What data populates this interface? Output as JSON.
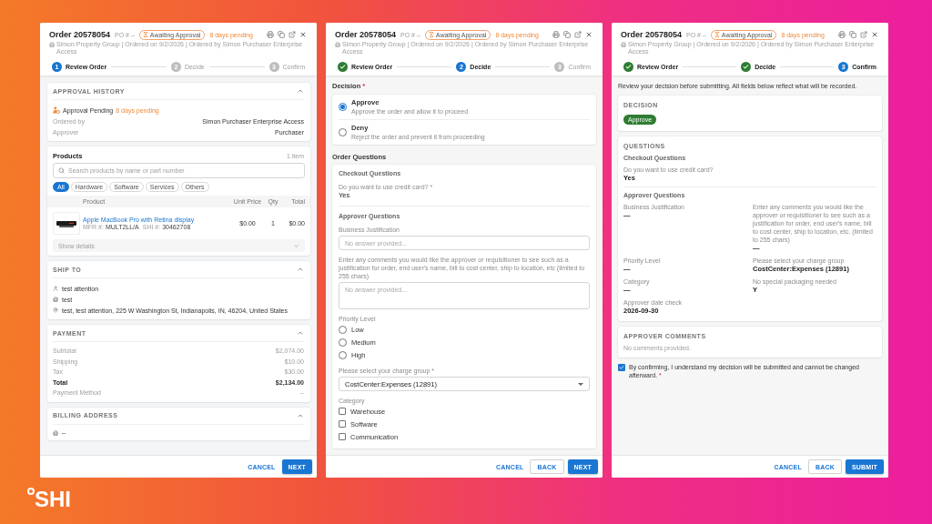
{
  "panels": [
    {
      "kind": "review",
      "header": {
        "title": "Order 20578054",
        "po": "PO # –",
        "badge": "Awaiting Approval",
        "pending": "8 days pending",
        "meta": "Simon Property Group | Ordered on 9/2/2026 | Ordered by Simon Purchaser Enterprise Access"
      },
      "steps": [
        {
          "kind": "current",
          "number": "1",
          "label": "Review Order"
        },
        {
          "kind": "upcoming",
          "number": "2",
          "label": "Decide"
        },
        {
          "kind": "upcoming",
          "number": "3",
          "label": "Confirm"
        }
      ],
      "sections": [
        {
          "kind": "history",
          "title": "APPROVAL HISTORY",
          "expanded": true,
          "status": "Approval Pending",
          "status_note": "8 days pending",
          "rows": [
            {
              "label": "Ordered by",
              "value": "Simon Purchaser Enterprise Access"
            },
            {
              "label": "Approver",
              "value": "Purchaser"
            }
          ]
        },
        {
          "kind": "products",
          "title": "Products",
          "count": "1 item",
          "search": {
            "placeholder": "Search products by name or part number"
          },
          "filters": [
            {
              "label": "All",
              "selected": true
            },
            {
              "label": "Hardware",
              "selected": false
            },
            {
              "label": "Software",
              "selected": false
            },
            {
              "label": "Services",
              "selected": false
            },
            {
              "label": "Others",
              "selected": false
            }
          ],
          "columns": [
            "Product",
            "Unit Price",
            "Qty",
            "Total"
          ],
          "rows": [
            {
              "name": "Apple MacBook Pro with Retina display",
              "mfr_label": "MFR #:",
              "mfr": "MULT2LL/A",
              "shi_label": "SHI #:",
              "shi": "30462708",
              "unit_price": "$0.00",
              "qty": "1",
              "total": "$0.00",
              "details": "Show details"
            }
          ]
        },
        {
          "kind": "address",
          "title": "SHIP TO",
          "expanded": true,
          "lines": [
            {
              "kind": "attention",
              "text": "test attention"
            },
            {
              "kind": "company",
              "text": "test"
            },
            {
              "kind": "location",
              "text": "test, test attention, 225 W Washington St, Indianapolis, IN, 46204, United States"
            }
          ]
        },
        {
          "kind": "payment",
          "title": "PAYMENT",
          "expanded": true,
          "rows": [
            {
              "kind": "line",
              "label": "Subtotal",
              "value": "$2,074.00"
            },
            {
              "kind": "line",
              "label": "Shipping",
              "value": "$10.00"
            },
            {
              "kind": "line",
              "label": "Tax",
              "value": "$30.00"
            },
            {
              "kind": "total",
              "label": "Total",
              "value": "$2,134.00"
            },
            {
              "kind": "line",
              "label": "Payment Method",
              "value": "–"
            }
          ]
        },
        {
          "kind": "address",
          "title": "BILLING ADDRESS",
          "expanded": true,
          "lines": [
            {
              "kind": "company",
              "text": "–"
            }
          ]
        }
      ],
      "buttons": [
        {
          "kind": "text",
          "label": "CANCEL"
        },
        {
          "kind": "primary",
          "label": "NEXT"
        }
      ]
    },
    {
      "kind": "decide",
      "header": {
        "title": "Order 20578054",
        "po": "PO # –",
        "badge": "Awaiting Approval",
        "pending": "8 days pending",
        "meta": "Simon Property Group | Ordered on 9/2/2026 | Ordered by Simon Purchaser Enterprise Access"
      },
      "steps": [
        {
          "kind": "done",
          "label": "Review Order"
        },
        {
          "kind": "current",
          "number": "2",
          "label": "Decide"
        },
        {
          "kind": "upcoming",
          "number": "3",
          "label": "Confirm"
        }
      ],
      "decision": {
        "label": "Decision",
        "required_mark": "*",
        "options": [
          {
            "label": "Approve",
            "description": "Approve the order and allow it to proceed",
            "selected": true
          },
          {
            "label": "Deny",
            "description": "Reject the order and prevent it from proceeding",
            "selected": false
          }
        ]
      },
      "questions": {
        "title": "Order Questions",
        "groups": [
          {
            "title": "Checkout Questions",
            "fields": [
              {
                "kind": "answer",
                "label": "Do you want to use credit card? *",
                "value": "Yes"
              }
            ]
          },
          {
            "title": "Approver Questions",
            "fields": [
              {
                "kind": "input",
                "label": "Business Justification",
                "placeholder": "No answer provided..."
              },
              {
                "kind": "textarea",
                "label": "Enter any comments you would like the approver or requisitioner to see such as a justification for order, end user's name, bill to cost center, ship to location, etc (limited to 255 chars)",
                "placeholder": "No answer provided..."
              },
              {
                "kind": "radio",
                "label": "Priority Level",
                "options": [
                  {
                    "label": "Low",
                    "selected": false
                  },
                  {
                    "label": "Medium",
                    "selected": false
                  },
                  {
                    "label": "High",
                    "selected": false
                  }
                ]
              },
              {
                "kind": "select",
                "label": "Please select your charge group *",
                "value": "CostCenter:Expenses (12891)"
              },
              {
                "kind": "checkbox",
                "label": "Category",
                "options": [
                  {
                    "label": "Warehouse",
                    "checked": false
                  },
                  {
                    "label": "Software",
                    "checked": false
                  },
                  {
                    "label": "Communication",
                    "checked": false
                  }
                ]
              }
            ]
          }
        ]
      },
      "buttons": [
        {
          "kind": "text",
          "label": "CANCEL"
        },
        {
          "kind": "outlined",
          "label": "BACK"
        },
        {
          "kind": "primary",
          "label": "NEXT"
        }
      ]
    },
    {
      "kind": "confirm",
      "header": {
        "title": "Order 20578054",
        "po": "PO # –",
        "badge": "Awaiting Approval",
        "pending": "8 days pending",
        "meta": "Simon Property Group | Ordered on 9/2/2026 | Ordered by Simon Purchaser Enterprise Access"
      },
      "steps": [
        {
          "kind": "done",
          "label": "Review Order"
        },
        {
          "kind": "done",
          "label": "Decide"
        },
        {
          "kind": "current",
          "number": "3",
          "label": "Confirm"
        }
      ],
      "intro": "Review your decision before submitting. All fields below reflect what will be recorded.",
      "cards": [
        {
          "kind": "decision",
          "title": "DECISION",
          "value": "Approve"
        },
        {
          "kind": "questions",
          "title": "QUESTIONS",
          "groups": [
            {
              "title": "Checkout Questions",
              "fields": [
                {
                  "label": "Do you want to use credit card?",
                  "value": "Yes"
                }
              ]
            },
            {
              "title": "Approver Questions",
              "fields": [
                {
                  "label": "Business Justification",
                  "value": "—"
                },
                {
                  "label": "Enter any comments you would like the approver or requisitioner to see such as a justification for order, end user's name, bill to cost center, ship to location, etc. (limited to 255 chars)",
                  "value": "—"
                },
                {
                  "label": "Priority Level",
                  "value": "—"
                },
                {
                  "label": "Please select your charge group",
                  "value": "CostCenter:Expenses (12891)"
                },
                {
                  "label": "Category",
                  "value": "—"
                },
                {
                  "label": "No special packaging needed",
                  "value": "Y"
                },
                {
                  "label": "Approver date check",
                  "value": "2026-09-30"
                }
              ]
            }
          ]
        },
        {
          "kind": "comments",
          "title": "APPROVER COMMENTS",
          "text": "No comments provided."
        }
      ],
      "confirmation": {
        "checked": true,
        "text": "By confirming, I understand my decision will be submitted and cannot be changed afterward.",
        "required_mark": "*"
      },
      "buttons": [
        {
          "kind": "text",
          "label": "CANCEL"
        },
        {
          "kind": "outlined",
          "label": "BACK"
        },
        {
          "kind": "primary",
          "label": "SUBMIT"
        }
      ]
    }
  ],
  "brand": {
    "logo_text": "SHI"
  }
}
